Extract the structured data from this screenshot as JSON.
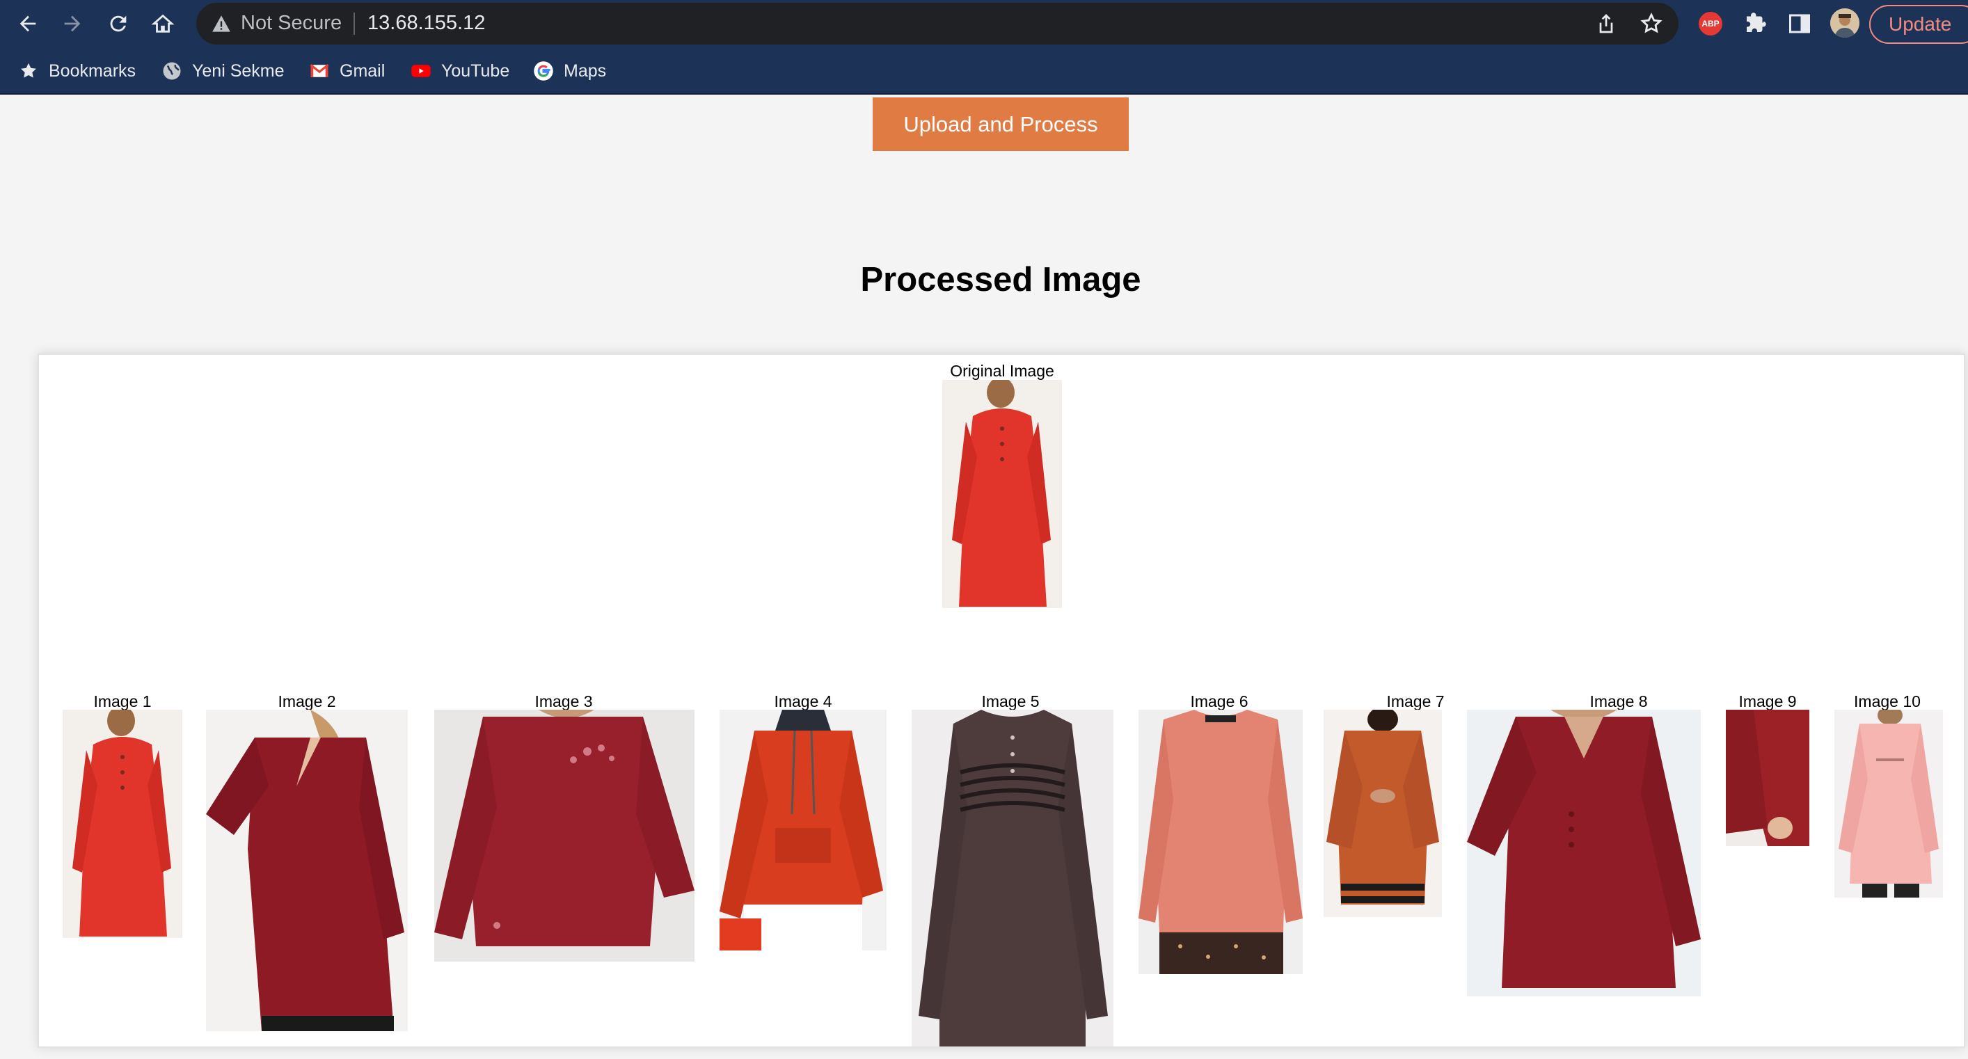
{
  "browser": {
    "security_label": "Not Secure",
    "url": "13.68.155.12",
    "update_label": "Update",
    "abp_label": "ABP"
  },
  "bookmarks": [
    {
      "label": "Bookmarks",
      "icon": "star-icon"
    },
    {
      "label": "Yeni Sekme",
      "icon": "globe-icon"
    },
    {
      "label": "Gmail",
      "icon": "gmail-icon"
    },
    {
      "label": "YouTube",
      "icon": "youtube-icon"
    },
    {
      "label": "Maps",
      "icon": "google-icon"
    }
  ],
  "page": {
    "upload_button_label": "Upload and Process",
    "title": "Processed Image",
    "original_label": "Original Image",
    "results": [
      {
        "label": "Image 1",
        "garment": "red tunic dress",
        "color": "#e1342a"
      },
      {
        "label": "Image 2",
        "garment": "v-neck tunic",
        "color": "#8e1a25"
      },
      {
        "label": "Image 3",
        "garment": "embroidered sweater",
        "color": "#98202c"
      },
      {
        "label": "Image 4",
        "garment": "hooded sweatshirt",
        "color": "#d83d1f"
      },
      {
        "label": "Image 5",
        "garment": "striped henley sweater",
        "color": "#4e3c3d"
      },
      {
        "label": "Image 6",
        "garment": "knit pullover",
        "color": "#e38473"
      },
      {
        "label": "Image 7",
        "garment": "turtleneck tunic",
        "color": "#c25a2c"
      },
      {
        "label": "Image 8",
        "garment": "v-neck blouse",
        "color": "#8f1c26"
      },
      {
        "label": "Image 9",
        "garment": "sleeve detail",
        "color": "#9b2127"
      },
      {
        "label": "Image 10",
        "garment": "pink sweatshirt",
        "color": "#f7b5b1"
      }
    ]
  }
}
